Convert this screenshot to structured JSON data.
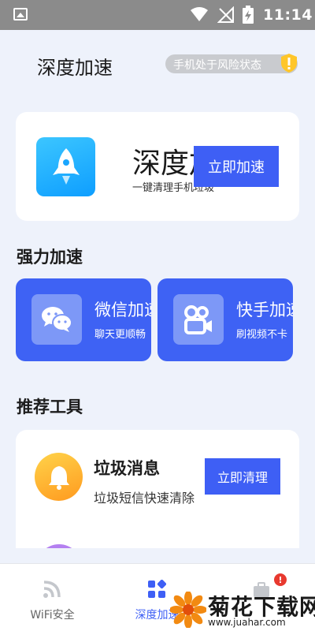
{
  "status_bar": {
    "time": "11:14",
    "icons": [
      "gallery-icon",
      "wifi-icon",
      "no-signal-icon",
      "battery-charging-icon"
    ]
  },
  "header": {
    "title": "深度加速",
    "risk_text": "手机处于风险状态",
    "risk_icon": "warning-icon"
  },
  "hero": {
    "icon": "rocket-icon",
    "title": "深度加速",
    "subtitle": "一键清理手机垃圾",
    "button_label": "立即加速"
  },
  "sections": {
    "strong_boost": "强力加速",
    "tools": "推荐工具"
  },
  "boost_cards": [
    {
      "title": "微信加速",
      "subtitle": "聊天更顺畅",
      "icon": "wechat-icon"
    },
    {
      "title": "快手加速",
      "subtitle": "刷视频不卡",
      "icon": "kuaishou-icon"
    }
  ],
  "tools": [
    {
      "title": "垃圾消息",
      "subtitle": "垃圾短信快速清除",
      "button_label": "立即清理",
      "icon": "bell-icon"
    }
  ],
  "bottom_nav": {
    "items": [
      {
        "label": "WiFi安全",
        "icon": "wifi-signal-icon",
        "active": false
      },
      {
        "label": "深度加速",
        "icon": "grid-icon",
        "active": true
      },
      {
        "label": "",
        "icon": "toolbox-icon",
        "active": false,
        "badge": "!"
      }
    ]
  },
  "watermark": {
    "name": "菊花下载网",
    "url": "www.juahar.com"
  },
  "colors": {
    "accent": "#3e5ff5",
    "background": "#eef2fb",
    "status_bar": "#8b8b8b",
    "warning": "#ffc629",
    "badge": "#e8392f"
  }
}
